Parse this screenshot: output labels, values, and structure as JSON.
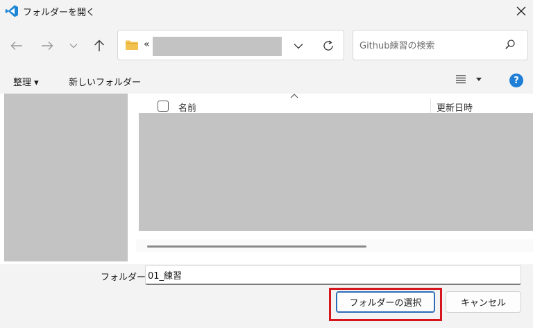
{
  "window": {
    "title": "フォルダーを開く"
  },
  "navigation": {
    "back_icon": "arrow-left-icon",
    "forward_icon": "arrow-right-icon",
    "recent_icon": "chevron-down-icon",
    "up_icon": "arrow-up-icon"
  },
  "address": {
    "overflow_marker": "«",
    "folder_icon": "folder-icon"
  },
  "search": {
    "placeholder": "Github練習の検索"
  },
  "toolbar": {
    "organize_label": "整理 ▾",
    "new_folder_label": "新しいフォルダー",
    "help_label": "?"
  },
  "columns": {
    "name": "名前",
    "date_modified": "更新日時"
  },
  "footer": {
    "folder_label": "フォルダー:",
    "folder_value": "01_練習",
    "select_button": "フォルダーの選択",
    "cancel_button": "キャンセル"
  },
  "colors": {
    "accent": "#2b6cb8",
    "highlight": "#d5161d",
    "redaction": "#c3c3c3",
    "folder": "#f2c14e"
  }
}
